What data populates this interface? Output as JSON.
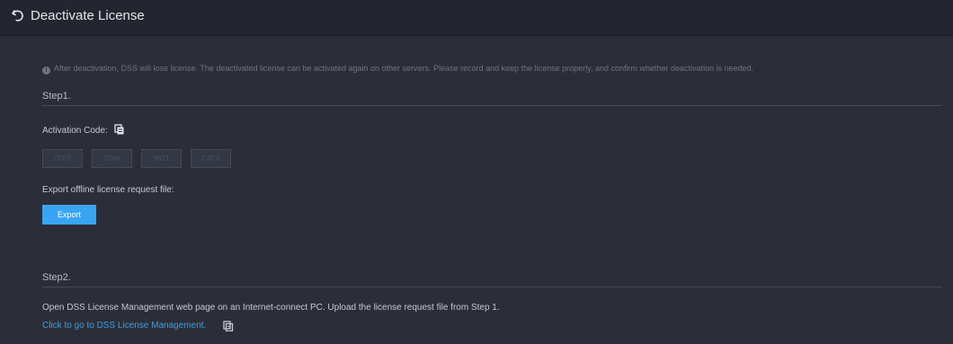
{
  "header": {
    "title": "Deactivate License",
    "back_icon": "undo-arrow-icon"
  },
  "notice": {
    "icon": "info-circle-icon",
    "text": "After deactivation, DSS will lose license. The deactivated license can be activated again on other servers. Please record and keep the license properly, and confirm whether deactivation is needed."
  },
  "step1": {
    "title": "Step1.",
    "activation_label": "Activation Code:",
    "copy_icon": "copy-icon",
    "code_segments": [
      "7FFS",
      "3360",
      "9621",
      "C4E4"
    ],
    "export_label": "Export offline license request file:",
    "export_button": "Export"
  },
  "step2": {
    "title": "Step2.",
    "description": "Open DSS License Management web page on an Internet-connect PC. Upload the license request file from Step 1.",
    "link_text": "Click to go to DSS License Management.",
    "copy_icon": "copy-icon"
  },
  "colors": {
    "background": "#2b2e38",
    "header": "#24262f",
    "accent": "#39a4f2",
    "link": "#3d9ee0"
  }
}
